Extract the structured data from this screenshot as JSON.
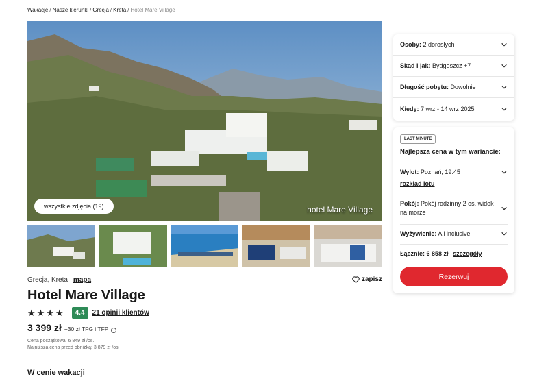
{
  "breadcrumb": {
    "items": [
      "Wakacje",
      "Nasze kierunki",
      "Grecja",
      "Kreta"
    ],
    "current": "Hotel Mare Village",
    "separator": "/"
  },
  "gallery": {
    "all_photos_label": "wszystkie zdjęcia (19)",
    "hero_caption": "hotel Mare Village"
  },
  "hotel": {
    "location": "Grecja, Kreta",
    "map_label": "mapa",
    "save_label": "zapisz",
    "name": "Hotel Mare Village",
    "stars": 4,
    "rating": "4.4",
    "reviews_label": "21 opinii klientów",
    "price": "3 399 zł",
    "fees_label": "+30 zł TFG i TFP",
    "price_notes": [
      "Cena początkowa: 6 849 zł /os.",
      "Najniższa cena przed obniżką: 3 879 zł /os."
    ]
  },
  "section_heading": "W cenie wakacji",
  "search": {
    "fields": [
      {
        "label": "Osoby:",
        "value": "2 dorosłych"
      },
      {
        "label": "Skąd i jak:",
        "value": "Bydgoszcz +7"
      },
      {
        "label": "Długość pobytu:",
        "value": "Dowolnie"
      },
      {
        "label": "Kiedy:",
        "value": "7 wrz - 14 wrz 2025"
      }
    ]
  },
  "offer": {
    "badge": "LAST MINUTE",
    "best_price_label": "Najlepsza cena w tym wariancie:",
    "departure_label": "Wylot:",
    "departure_value": "Poznań, 19:45",
    "flight_link": "rozkład lotu",
    "room_label": "Pokój:",
    "room_value": "Pokój rodzinny 2 os. widok na morze",
    "board_label": "Wyżywienie:",
    "board_value": "All inclusive",
    "total_label": "Łącznie:",
    "total_value": "6 858 zł",
    "details_label": "szczegóły",
    "reserve_label": "Rezerwuj"
  },
  "colors": {
    "accent": "#e0282f",
    "rating_badge": "#2e8b57"
  }
}
